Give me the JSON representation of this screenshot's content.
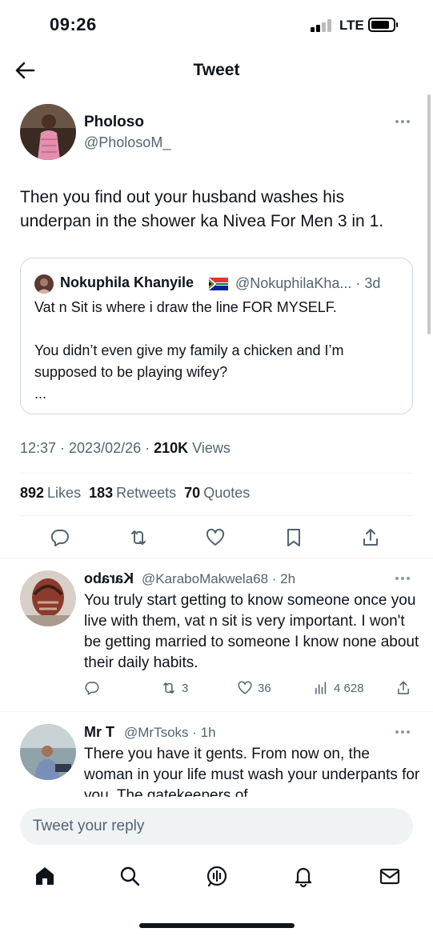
{
  "status_bar": {
    "time": "09:26",
    "network": "LTE"
  },
  "header": {
    "title": "Tweet"
  },
  "tweet": {
    "author_name": "Pholoso",
    "author_handle": "@PholosoM_",
    "text": "Then you find out your husband washes his underpan in the shower ka Nivea For Men 3 in 1.",
    "quoted": {
      "author_name": "Nokuphila Khanyile",
      "handle_time": "@NokuphilaKha... · 3d",
      "text": "Vat n Sit is where i draw the line FOR MYSELF.\n\nYou didn’t even give my family a chicken and I’m supposed to be playing wifey?\n..."
    },
    "timestamp": "12:37 · 2023/02/26 · ",
    "views_count": "210K",
    "views_label": " Views",
    "likes_count": "892",
    "likes_label": "Likes",
    "retweets_count": "183",
    "retweets_label": "Retweets",
    "quotes_count": "70",
    "quotes_label": "Quotes"
  },
  "replies": [
    {
      "name": "Karabo",
      "handle_time": "@KaraboMakwela68 · 2h",
      "text": "You truly start getting to know someone once you live with them, vat n sit is very important. I won't be getting married to someone I know none about their daily habits.",
      "retweets": "3",
      "likes": "36",
      "views": "4 628"
    },
    {
      "name": "Mr T",
      "handle_time": "@MrTsoks · 1h",
      "text": "There you have it gents. From now on, the woman in your life must wash your underpants for you. The gatekeepers of"
    }
  ],
  "composer": {
    "placeholder": "Tweet your reply"
  },
  "tabs": [
    "home-icon",
    "search-icon",
    "spaces-icon",
    "notifications-icon",
    "messages-icon"
  ],
  "colors": {
    "text": "#0f1419",
    "secondary": "#536471",
    "border": "#cfd9de",
    "input_bg": "#eff3f4"
  }
}
